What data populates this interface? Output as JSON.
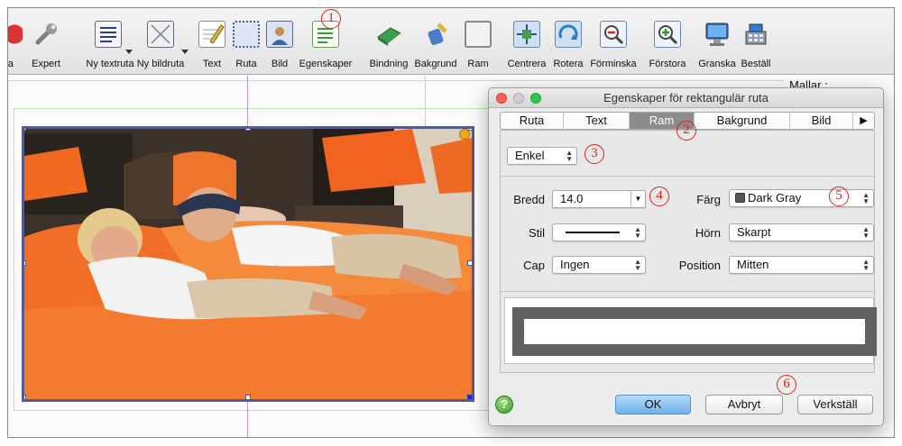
{
  "toolbar": {
    "items": [
      {
        "label": "ra",
        "icon": "partial-red-icon"
      },
      {
        "label": "Expert",
        "icon": "wrench-icon"
      },
      {
        "label": "Ny textruta",
        "icon": "text-frame-icon"
      },
      {
        "label": "Ny bildruta",
        "icon": "image-frame-icon"
      },
      {
        "label": "Text",
        "icon": "pencil-notepad-icon"
      },
      {
        "label": "Ruta",
        "icon": "dotted-box-icon"
      },
      {
        "label": "Bild",
        "icon": "portrait-icon"
      },
      {
        "label": "Egenskaper",
        "icon": "properties-document-icon"
      },
      {
        "label": "Bindning",
        "icon": "green-book-icon"
      },
      {
        "label": "Bakgrund",
        "icon": "paint-bucket-icon"
      },
      {
        "label": "Ram",
        "icon": "frame-icon"
      },
      {
        "label": "Centrera",
        "icon": "center-arrows-icon"
      },
      {
        "label": "Rotera",
        "icon": "rotate-icon"
      },
      {
        "label": "Förminska",
        "icon": "zoom-out-image-icon"
      },
      {
        "label": "Förstora",
        "icon": "zoom-in-image-icon"
      },
      {
        "label": "Granska",
        "icon": "monitor-icon"
      },
      {
        "label": "Beställ",
        "icon": "cash-register-icon"
      }
    ]
  },
  "side_panel": {
    "title": "Mallar :"
  },
  "dialog": {
    "title": "Egenskaper för rektangulär ruta",
    "tabs": [
      "Ruta",
      "Text",
      "Ram",
      "Bakgrund",
      "Bild"
    ],
    "active_tab": "Ram",
    "more_tabs": "▶",
    "mode_select": "Enkel",
    "fields": {
      "bredd": {
        "label": "Bredd",
        "value": "14.0"
      },
      "farg": {
        "label": "Färg",
        "value": "Dark Gray",
        "swatch": "#555555"
      },
      "stil": {
        "label": "Stil"
      },
      "horn": {
        "label": "Hörn",
        "value": "Skarpt"
      },
      "cap": {
        "label": "Cap",
        "value": "Ingen"
      },
      "position": {
        "label": "Position",
        "value": "Mitten"
      }
    },
    "buttons": {
      "ok": "OK",
      "cancel": "Avbryt",
      "apply": "Verkställ",
      "help": "?"
    }
  },
  "callouts": [
    "1",
    "2",
    "3",
    "4",
    "5",
    "6"
  ],
  "colors": {
    "callout": "#d9231c",
    "frame_border": "#555b8a",
    "ok_button": "#6eb1ee",
    "preview_border": "#606060"
  }
}
